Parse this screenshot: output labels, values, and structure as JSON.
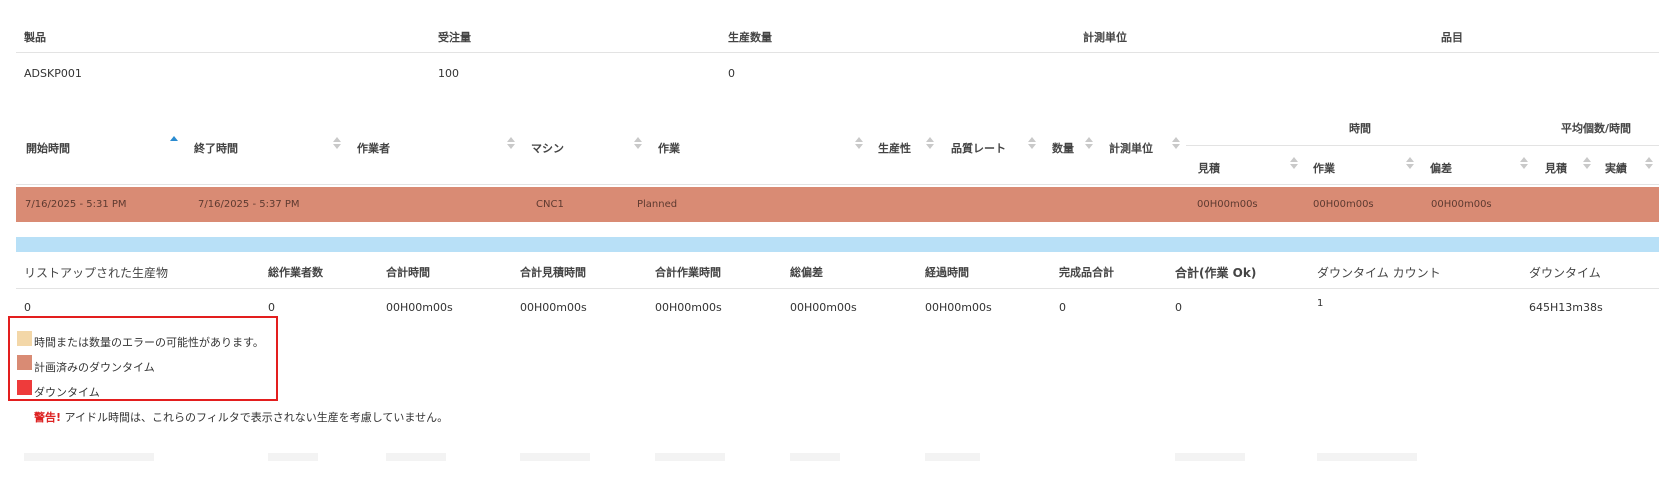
{
  "product_table": {
    "headers": [
      "製品",
      "受注量",
      "生産数量",
      "計測単位",
      "品目"
    ],
    "row": [
      "ADSKP001",
      "100",
      "0",
      "",
      ""
    ]
  },
  "activity_table": {
    "headers": {
      "start": "開始時間",
      "end": "終了時間",
      "operator": "作業者",
      "machine": "マシン",
      "job": "作業",
      "productivity": "生産性",
      "quality_rate": "品質レート",
      "quantity": "数量",
      "uom": "計測単位",
      "time_group": "時間",
      "time_estimate": "見積",
      "time_work": "作業",
      "time_deviation": "偏差",
      "avg_group": "平均個数/時間",
      "avg_estimate": "見積",
      "avg_actual": "実績"
    },
    "rows": [
      {
        "start": "7/16/2025 - 5:31 PM",
        "end": "7/16/2025 - 5:37 PM",
        "operator": "",
        "machine": "CNC1",
        "job": "Planned",
        "estimate": "00H00m00s",
        "work": "00H00m00s",
        "deviation": "00H00m00s",
        "status_color": "#d98b74"
      }
    ]
  },
  "summary_table": {
    "headers": [
      "リストアップされた生産物",
      "総作業者数",
      "合計時間",
      "合計見積時間",
      "合計作業時間",
      "総偏差",
      "経過時間",
      "完成品合計",
      "合計(作業 Ok)",
      "ダウンタイム カウント",
      "ダウンタイム"
    ],
    "values": [
      "0",
      "0",
      "00H00m00s",
      "00H00m00s",
      "00H00m00s",
      "00H00m00s",
      "00H00m00s",
      "0",
      "0",
      "1",
      "645H13m38s"
    ]
  },
  "legend": [
    {
      "label": "時間または数量のエラーの可能性があります。",
      "color": "#f3d7a8"
    },
    {
      "label": "計画済みのダウンタイム",
      "color": "#d98b74"
    },
    {
      "label": "ダウンタイム",
      "color": "#ee3b3b"
    }
  ],
  "warning": {
    "prefix": "警告!",
    "text": " アイドル時間は、これらのフィルタで表示されない生産を考慮していません。"
  },
  "colors": {
    "planned_row": "#d98b74",
    "info_bar": "#b8e0f7",
    "highlight_border": "#e31e1e",
    "sort_active": "#2a8bd0"
  }
}
